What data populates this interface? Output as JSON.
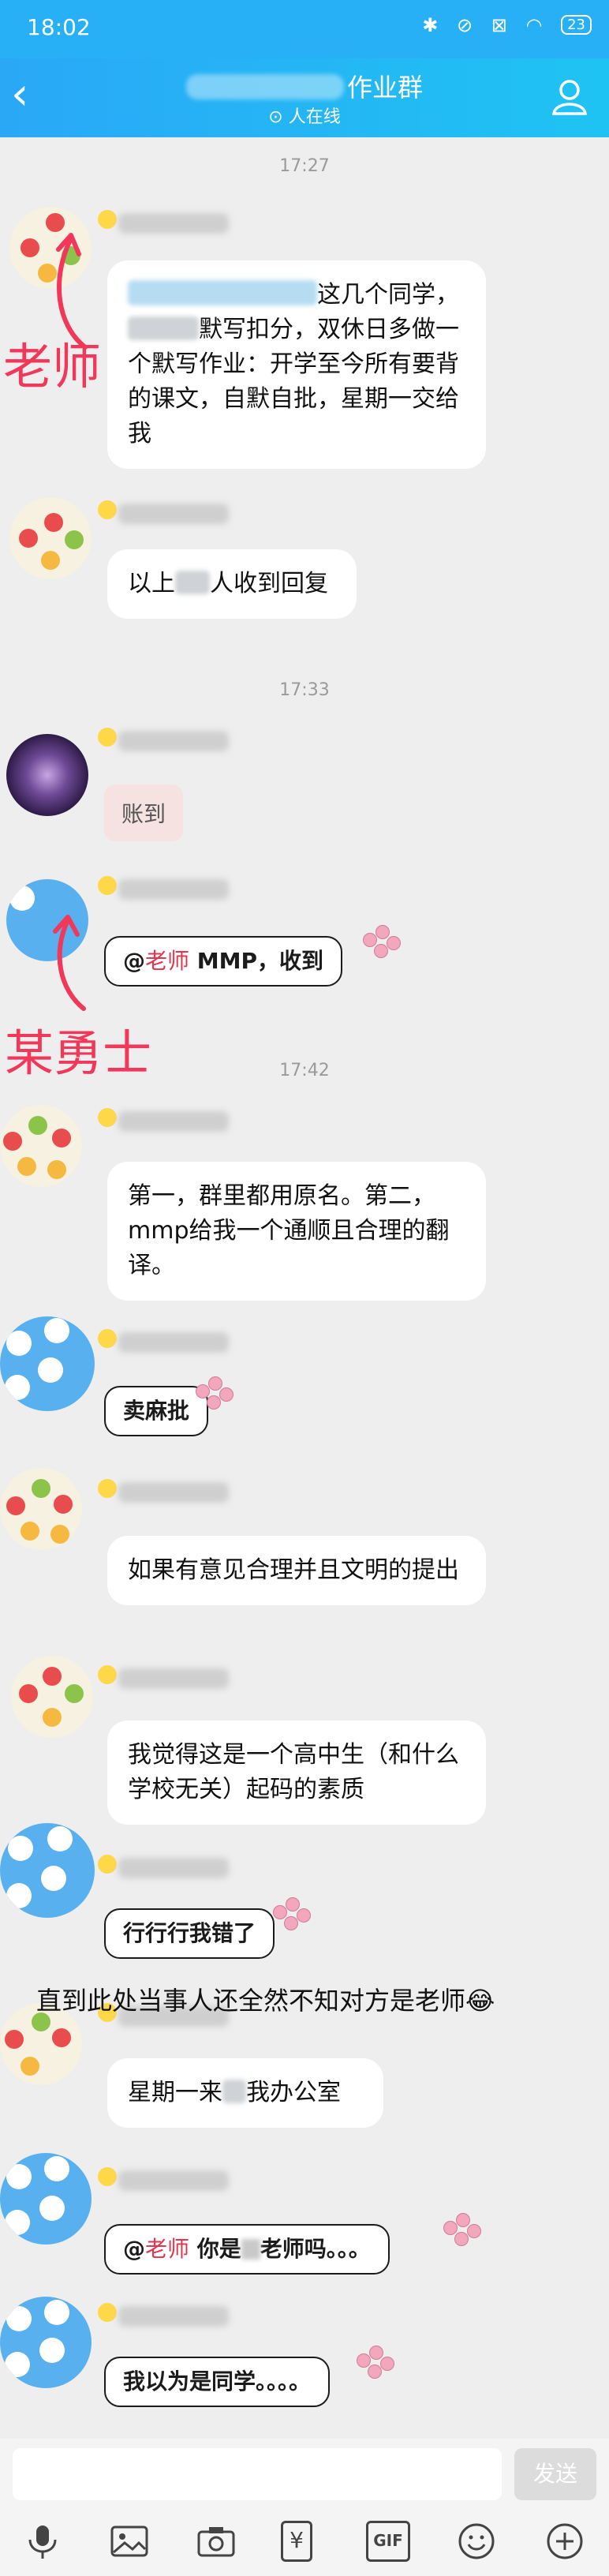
{
  "status_bar": {
    "time": "18:02",
    "icons_text": "✱ ⊘ ⊠ ◠",
    "battery": "23"
  },
  "header": {
    "title": "作业群",
    "online": "人在线"
  },
  "timestamps": [
    "17:27",
    "17:33",
    "17:42"
  ],
  "messages": {
    "m1": {
      "text_a": "这几个同学，",
      "text_b": "默写扣分，双休日多做一个默写作业：开学至今所有要背的课文，自默自批，星期一交给我"
    },
    "m2": {
      "pre": "以上",
      "post": "人收到回复"
    },
    "m3": {
      "text": "账到"
    },
    "m4": {
      "at": "@",
      "name": "老师",
      "text": "MMP，收到"
    },
    "m5": {
      "text": "第一，群里都用原名。第二，mmp给我一个通顺且合理的翻译。"
    },
    "m6": {
      "text": "卖麻批"
    },
    "m7": {
      "text": "如果有意见合理并且文明的提出"
    },
    "m8": {
      "text": "我觉得这是一个高中生（和什么学校无关）起码的素质"
    },
    "m9": {
      "text": "行行行我错了"
    },
    "m10": {
      "pre": "星期一来",
      "post": "我办公室"
    },
    "m11": {
      "at": "@",
      "name": "老师",
      "mid": "你是",
      "post": "老师吗。。。"
    },
    "m12": {
      "text": "我以为是同学。。。。"
    }
  },
  "annotations": {
    "teacher": "老师",
    "warrior": "某勇士",
    "note": "直到此处当事人还全然不知对方是老师😂"
  },
  "input": {
    "placeholder": "",
    "send": "发送"
  },
  "toolbar": [
    "mic-icon",
    "image-icon",
    "camera-icon",
    "red-packet-icon",
    "gif-icon",
    "emoji-icon",
    "plus-icon"
  ],
  "toolbar_labels": {
    "gif": "GIF",
    "red_packet": "¥"
  },
  "colors": {
    "header": "#27b0f5",
    "annotation": "#f2385a",
    "background": "#eeeeee"
  }
}
